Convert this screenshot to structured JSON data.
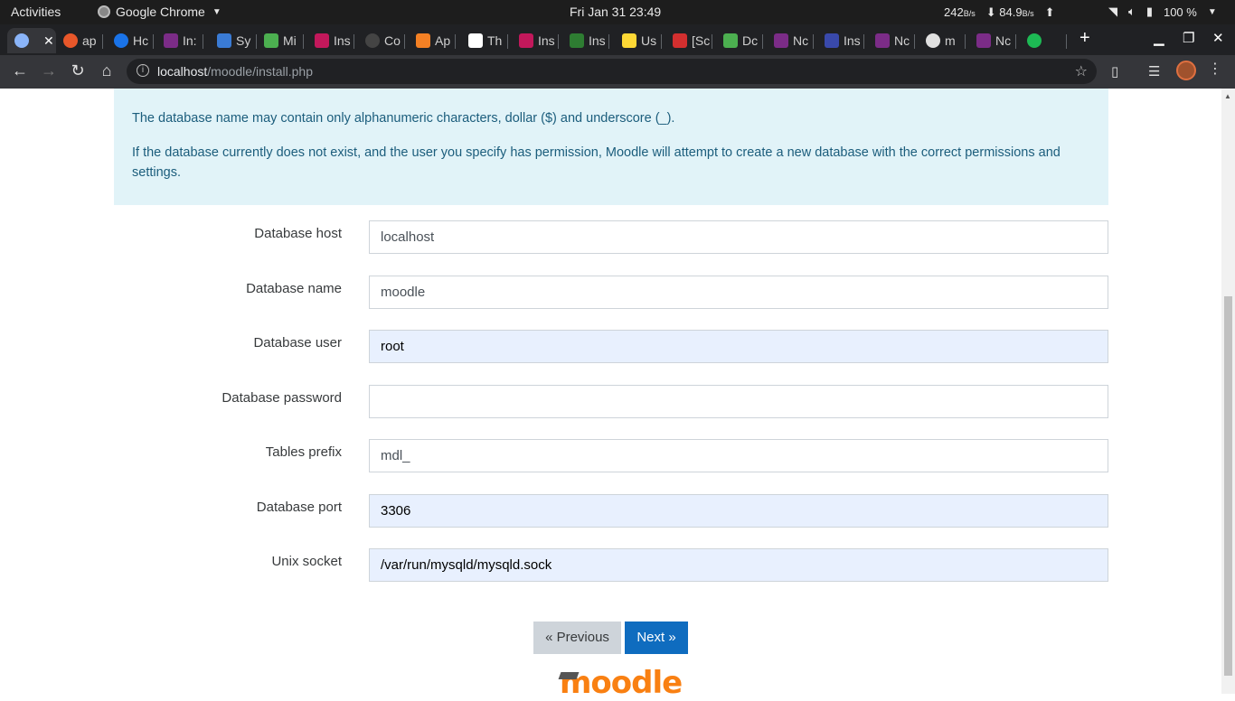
{
  "topbar": {
    "activities": "Activities",
    "app_name": "Google Chrome",
    "clock": "Fri Jan 31  23:49",
    "net_up_value": "242",
    "net_up_unit": "B/s",
    "net_down_value": "84.9",
    "net_down_unit": "B/s",
    "battery": "100 %"
  },
  "tabs": [
    {
      "label": "",
      "icon": "globe-icon",
      "color": "#8ab4f8",
      "active": true
    },
    {
      "label": "ap",
      "icon": "ask-icon",
      "color": "#e8572a"
    },
    {
      "label": "Hc",
      "icon": "blue-circle-icon",
      "color": "#1a73e8"
    },
    {
      "label": "In:",
      "icon": "moodle-icon",
      "color": "#7b2c87"
    },
    {
      "label": "Sy",
      "icon": "chat-icon",
      "color": "#3a7bd5"
    },
    {
      "label": "Mi",
      "icon": "green-icon",
      "color": "#4caf50"
    },
    {
      "label": "Ins",
      "icon": "magenta-icon",
      "color": "#c2185b"
    },
    {
      "label": "Co",
      "icon": "github-icon",
      "color": "#444"
    },
    {
      "label": "Ap",
      "icon": "stackoverflow-icon",
      "color": "#f48024"
    },
    {
      "label": "Th",
      "icon": "slash-icon",
      "color": "#fff"
    },
    {
      "label": "Ins",
      "icon": "magenta-icon",
      "color": "#c2185b"
    },
    {
      "label": "Ins",
      "icon": "bird-icon",
      "color": "#2e7d32"
    },
    {
      "label": "Us",
      "icon": "bulb-icon",
      "color": "#fdd835"
    },
    {
      "label": "[Sc",
      "icon": "a-icon",
      "color": "#d32f2f"
    },
    {
      "label": "Dc",
      "icon": "green-icon",
      "color": "#4caf50"
    },
    {
      "label": "Nc",
      "icon": "moodle-icon",
      "color": "#7b2c87"
    },
    {
      "label": "Ins",
      "icon": "moodle-icon",
      "color": "#3949ab"
    },
    {
      "label": "Nc",
      "icon": "moodle-icon",
      "color": "#7b2c87"
    },
    {
      "label": "m",
      "icon": "globe-icon",
      "color": "#e0e0e0"
    },
    {
      "label": "Nc",
      "icon": "moodle-icon",
      "color": "#7b2c87"
    },
    {
      "label": "",
      "icon": "spotify-icon",
      "color": "#1db954"
    }
  ],
  "address": {
    "host": "localhost",
    "path": "/moodle/install.php"
  },
  "notice": {
    "line1": "The database name may contain only alphanumeric characters, dollar ($) and underscore (_).",
    "line2": "If the database currently does not exist, and the user you specify has permission, Moodle will attempt to create a new database with the correct permissions and settings."
  },
  "form": {
    "db_host_label": "Database host",
    "db_host_value": "localhost",
    "db_name_label": "Database name",
    "db_name_value": "moodle",
    "db_user_label": "Database user",
    "db_user_value": "root",
    "db_password_label": "Database password",
    "db_password_value": "",
    "prefix_label": "Tables prefix",
    "prefix_value": "mdl_",
    "port_label": "Database port",
    "port_value": "3306",
    "socket_label": "Unix socket",
    "socket_value": "/var/run/mysqld/mysqld.sock"
  },
  "buttons": {
    "previous": "« Previous",
    "next": "Next »"
  },
  "logo_text": "moodle"
}
